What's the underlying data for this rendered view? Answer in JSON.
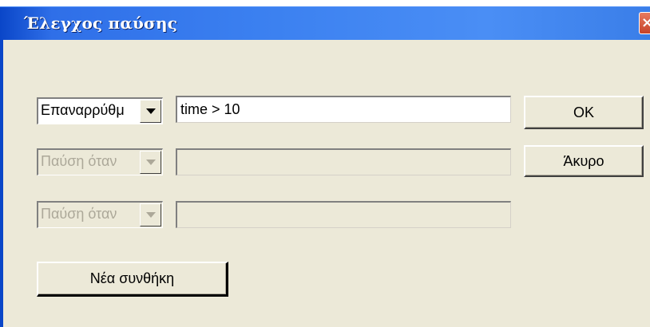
{
  "window": {
    "title": "Έλεγχος παύσης",
    "close_label": "×"
  },
  "conditions": [
    {
      "type": "Επαναρρύθμιση",
      "type_display": "Επαναρρύθμ",
      "expression": "time > 10",
      "enabled": true
    },
    {
      "type": "Παύση όταν",
      "type_display": "Παύση όταν",
      "expression": "",
      "enabled": false
    },
    {
      "type": "Παύση όταν",
      "type_display": "Παύση όταν",
      "expression": "",
      "enabled": false
    }
  ],
  "buttons": {
    "ok": "OK",
    "cancel": "Άκυρο",
    "new_condition": "Νέα συνθήκη"
  },
  "icons": {
    "dropdown": "chevron-down-icon",
    "close": "close-icon"
  },
  "colors": {
    "titlebar": "#2f6fe8",
    "dialog_bg": "#ece9d8",
    "disabled_text": "#aca899"
  }
}
